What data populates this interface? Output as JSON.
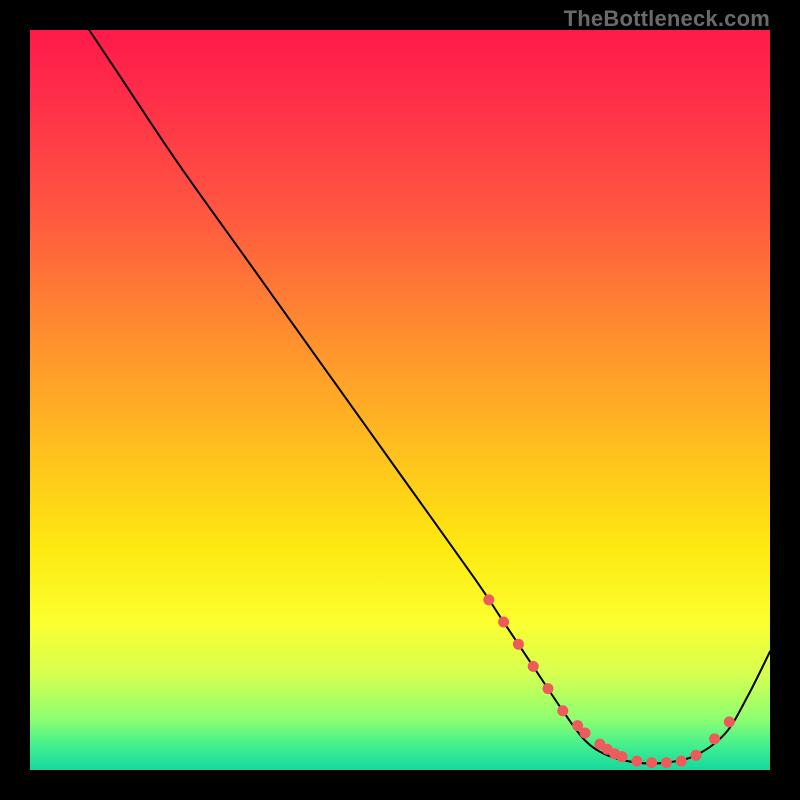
{
  "watermark": "TheBottleneck.com",
  "chart_data": {
    "type": "line",
    "title": "",
    "xlabel": "",
    "ylabel": "",
    "xlim": [
      0,
      100
    ],
    "ylim": [
      0,
      100
    ],
    "series": [
      {
        "name": "curve",
        "x": [
          8,
          12,
          20,
          30,
          40,
          50,
          60,
          64,
          68,
          72,
          75,
          78,
          82,
          86,
          90,
          94,
          97,
          100
        ],
        "y": [
          100,
          94,
          82,
          68,
          54,
          40,
          26,
          20,
          14,
          8,
          4,
          2,
          1,
          1,
          2,
          5,
          10,
          16
        ]
      }
    ],
    "points": {
      "name": "dots",
      "x": [
        62,
        64,
        66,
        68,
        70,
        72,
        74,
        75,
        77,
        78,
        79,
        80,
        82,
        84,
        86,
        88,
        90,
        92.5,
        94.5
      ],
      "y": [
        23,
        20,
        17,
        14,
        11,
        8,
        6,
        5,
        3.5,
        2.8,
        2.2,
        1.8,
        1.2,
        1,
        1,
        1.2,
        2,
        4.2,
        6.5
      ]
    }
  }
}
